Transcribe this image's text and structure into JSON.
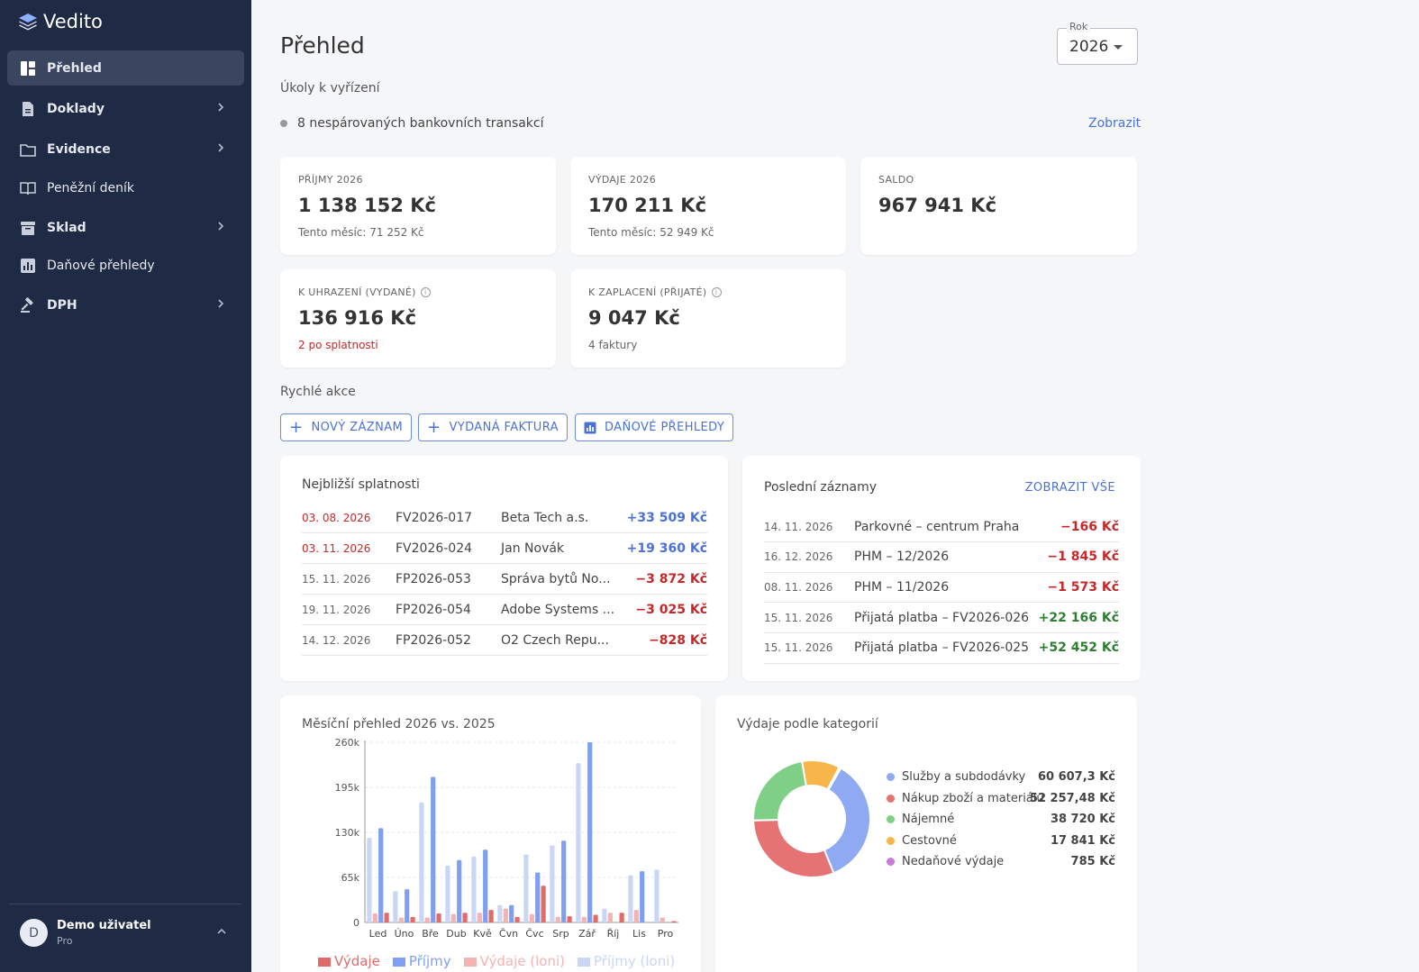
{
  "app": {
    "name": "Vedito"
  },
  "sidebar": {
    "items": [
      {
        "label": "Přehled",
        "icon": "dashboard-icon",
        "active": true,
        "bold": true,
        "chevron": false
      },
      {
        "label": "Doklady",
        "icon": "document-icon",
        "active": false,
        "bold": true,
        "chevron": true
      },
      {
        "label": "Evidence",
        "icon": "folder-icon",
        "active": false,
        "bold": true,
        "chevron": true
      },
      {
        "label": "Peněžní deník",
        "icon": "book-icon",
        "active": false,
        "bold": false,
        "chevron": false
      },
      {
        "label": "Sklad",
        "icon": "archive-icon",
        "active": false,
        "bold": true,
        "chevron": true
      },
      {
        "label": "Daňové přehledy",
        "icon": "bar-chart-icon",
        "active": false,
        "bold": false,
        "chevron": false
      },
      {
        "label": "DPH",
        "icon": "gavel-icon",
        "active": false,
        "bold": true,
        "chevron": true
      }
    ],
    "user": {
      "initial": "D",
      "name": "Demo uživatel",
      "plan": "Pro"
    }
  },
  "header": {
    "title": "Přehled",
    "year_label": "Rok",
    "year_value": "2026"
  },
  "tasks": {
    "heading": "Úkoly k vyřízení",
    "items": [
      {
        "text": "8 nespárovaných bankovních transakcí",
        "link": "Zobrazit"
      }
    ]
  },
  "kpis": [
    {
      "label": "PŘÍJMY 2026",
      "value": "1 138 152 Kč",
      "sub": "Tento měsíc: 71 252 Kč",
      "info": false,
      "sub_alert": false
    },
    {
      "label": "VÝDAJE 2026",
      "value": "170 211 Kč",
      "sub": "Tento měsíc: 52 949 Kč",
      "info": false,
      "sub_alert": false
    },
    {
      "label": "SALDO",
      "value": "967 941 Kč",
      "sub": "",
      "info": false,
      "sub_alert": false
    },
    {
      "label": "K UHRAZENÍ (VYDANÉ)",
      "value": "136 916 Kč",
      "sub": "2 po splatnosti",
      "info": true,
      "sub_alert": true
    },
    {
      "label": "K ZAPLACENÍ (PŘIJATÉ)",
      "value": "9 047 Kč",
      "sub": "4 faktury",
      "info": true,
      "sub_alert": false
    }
  ],
  "quick_actions": {
    "heading": "Rychlé akce",
    "buttons": [
      {
        "label": "NOVÝ ZÁZNAM",
        "icon": "plus-icon"
      },
      {
        "label": "VYDANÁ FAKTURA",
        "icon": "plus-icon"
      },
      {
        "label": "DAŇOVÉ PŘEHLEDY",
        "icon": "report-icon"
      }
    ]
  },
  "due": {
    "title": "Nejbližší splatnosti",
    "rows": [
      {
        "date": "03. 08. 2026",
        "overdue": true,
        "number": "FV2026-017",
        "partner": "Beta Tech a.s.",
        "amount": "+33 509 Kč",
        "kind": "pos-blue"
      },
      {
        "date": "03. 11. 2026",
        "overdue": true,
        "number": "FV2026-024",
        "partner": "Jan Novák",
        "amount": "+19 360 Kč",
        "kind": "pos-blue"
      },
      {
        "date": "15. 11. 2026",
        "overdue": false,
        "number": "FP2026-053",
        "partner": "Správa bytů No...",
        "amount": "−3 872 Kč",
        "kind": "neg"
      },
      {
        "date": "19. 11. 2026",
        "overdue": false,
        "number": "FP2026-054",
        "partner": "Adobe Systems ...",
        "amount": "−3 025 Kč",
        "kind": "neg"
      },
      {
        "date": "14. 12. 2026",
        "overdue": false,
        "number": "FP2026-052",
        "partner": "O2 Czech Repu...",
        "amount": "−828 Kč",
        "kind": "neg"
      }
    ]
  },
  "recent": {
    "title": "Poslední záznamy",
    "link": "ZOBRAZIT VŠE",
    "rows": [
      {
        "date": "14. 11. 2026",
        "text": "Parkovné – centrum Praha",
        "amount": "−166 Kč",
        "kind": "neg"
      },
      {
        "date": "16. 12. 2026",
        "text": "PHM – 12/2026",
        "amount": "−1 845 Kč",
        "kind": "neg"
      },
      {
        "date": "08. 11. 2026",
        "text": "PHM – 11/2026",
        "amount": "−1 573 Kč",
        "kind": "neg"
      },
      {
        "date": "15. 11. 2026",
        "text": "Přijatá platba – FV2026-026",
        "amount": "+22 166 Kč",
        "kind": "pos-green"
      },
      {
        "date": "15. 11. 2026",
        "text": "Přijatá platba – FV2026-025",
        "amount": "+52 452 Kč",
        "kind": "pos-green"
      }
    ]
  },
  "chart_data": [
    {
      "type": "bar",
      "title": "Měsíční přehled 2026 vs. 2025",
      "categories": [
        "Led",
        "Úno",
        "Bře",
        "Dub",
        "Kvě",
        "Čvn",
        "Čvc",
        "Srp",
        "Zář",
        "Říj",
        "Lis",
        "Pro"
      ],
      "y_ticks": [
        "0",
        "65k",
        "130k",
        "195k",
        "260k"
      ],
      "ylim": [
        0,
        260000
      ],
      "grid": true,
      "legend": "bottom",
      "series": [
        {
          "name": "Příjmy (loni)",
          "color": "#c9d6f5",
          "values": [
            122000,
            45000,
            173000,
            82000,
            95000,
            25000,
            98000,
            111000,
            230000,
            20000,
            68000,
            76000
          ]
        },
        {
          "name": "Výdaje (loni)",
          "color": "#f3b3b3",
          "values": [
            13000,
            7000,
            7000,
            12000,
            14000,
            20000,
            12000,
            8000,
            8000,
            14000,
            18000,
            7000
          ]
        },
        {
          "name": "Příjmy",
          "color": "#7f9ff0",
          "values": [
            136000,
            48000,
            210000,
            90000,
            105000,
            25000,
            72000,
            118000,
            260000,
            0,
            74000,
            0
          ]
        },
        {
          "name": "Výdaje",
          "color": "#e06b6b",
          "values": [
            14000,
            8000,
            13000,
            14000,
            18000,
            8000,
            53000,
            9000,
            11000,
            14000,
            0,
            2000
          ]
        }
      ],
      "legend_order": [
        "Výdaje",
        "Příjmy",
        "Výdaje (loni)",
        "Příjmy (loni)"
      ]
    },
    {
      "type": "pie",
      "title": "Výdaje podle kategorií",
      "slices": [
        {
          "label": "Služby a subdodávky",
          "value": 60607.3,
          "display": "60 607,3 Kč",
          "color": "#8fa9f2"
        },
        {
          "label": "Nákup zboží a materiálu",
          "value": 52257.48,
          "display": "52 257,48 Kč",
          "color": "#e57373"
        },
        {
          "label": "Nájemné",
          "value": 38720,
          "display": "38 720 Kč",
          "color": "#7fcf86"
        },
        {
          "label": "Cestovné",
          "value": 17841,
          "display": "17 841 Kč",
          "color": "#f7b54a"
        },
        {
          "label": "Nedaňové výdaje",
          "value": 785,
          "display": "785 Kč",
          "color": "#c77ad6"
        }
      ]
    }
  ]
}
